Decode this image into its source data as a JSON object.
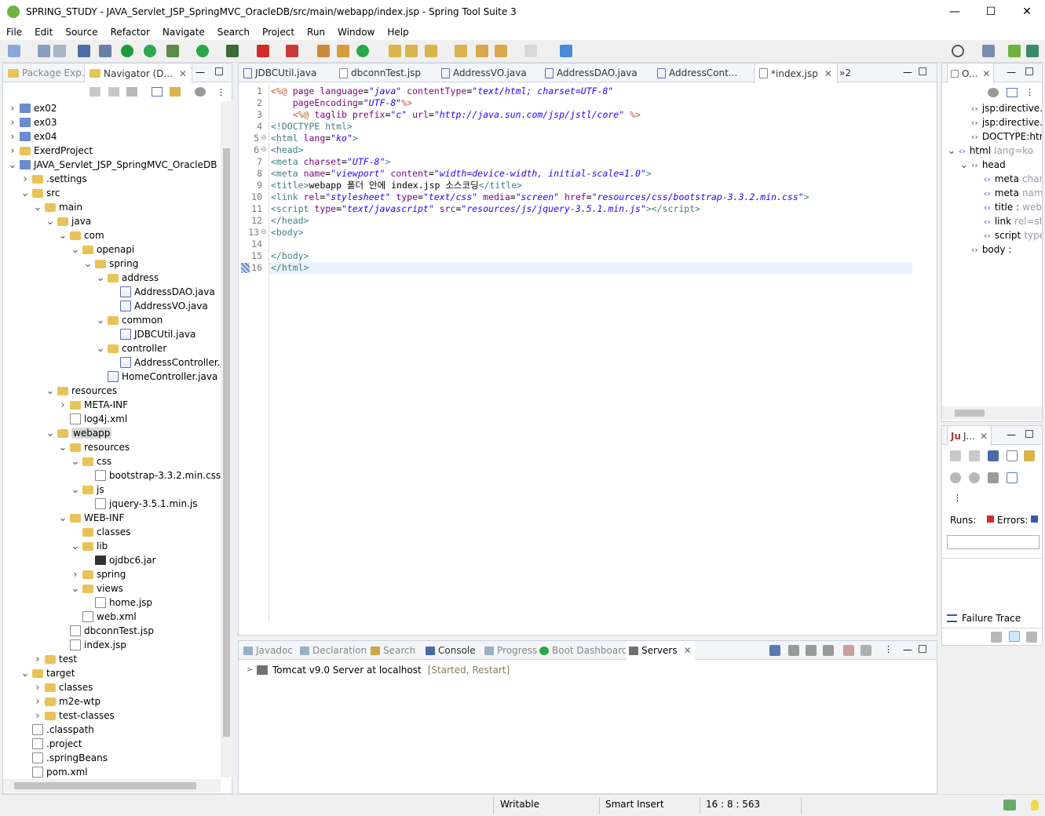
{
  "window": {
    "title": "SPRING_STUDY - JAVA_Servlet_JSP_SpringMVC_OracleDB/src/main/webapp/index.jsp - Spring Tool Suite 3",
    "minimize_glyph": "—",
    "maximize_glyph": "☐",
    "close_glyph": "✕"
  },
  "menu": [
    "File",
    "Edit",
    "Source",
    "Refactor",
    "Navigate",
    "Search",
    "Project",
    "Run",
    "Window",
    "Help"
  ],
  "left_panel": {
    "tabs": [
      "Package Exp...",
      "Navigator (D..."
    ],
    "tree": [
      {
        "label": "ex02",
        "depth": 0,
        "icon": "proj",
        "twisty": ">"
      },
      {
        "label": "ex03",
        "depth": 0,
        "icon": "proj",
        "twisty": ">"
      },
      {
        "label": "ex04",
        "depth": 0,
        "icon": "proj",
        "twisty": ">"
      },
      {
        "label": "ExerdProject",
        "depth": 0,
        "icon": "folder",
        "twisty": ">"
      },
      {
        "label": "JAVA_Servlet_JSP_SpringMVC_OracleDB",
        "depth": 0,
        "icon": "proj",
        "twisty": "v"
      },
      {
        "label": ".settings",
        "depth": 1,
        "icon": "folder",
        "twisty": ">"
      },
      {
        "label": "src",
        "depth": 1,
        "icon": "folder",
        "twisty": "v"
      },
      {
        "label": "main",
        "depth": 2,
        "icon": "folder",
        "twisty": "v"
      },
      {
        "label": "java",
        "depth": 3,
        "icon": "folder",
        "twisty": "v"
      },
      {
        "label": "com",
        "depth": 4,
        "icon": "folder",
        "twisty": "v"
      },
      {
        "label": "openapi",
        "depth": 5,
        "icon": "folder",
        "twisty": "v"
      },
      {
        "label": "spring",
        "depth": 6,
        "icon": "folder",
        "twisty": "v"
      },
      {
        "label": "address",
        "depth": 7,
        "icon": "folder",
        "twisty": "v"
      },
      {
        "label": "AddressDAO.java",
        "depth": 8,
        "icon": "java",
        "twisty": ""
      },
      {
        "label": "AddressVO.java",
        "depth": 8,
        "icon": "java",
        "twisty": ""
      },
      {
        "label": "common",
        "depth": 7,
        "icon": "folder",
        "twisty": "v"
      },
      {
        "label": "JDBCUtil.java",
        "depth": 8,
        "icon": "java",
        "twisty": ""
      },
      {
        "label": "controller",
        "depth": 7,
        "icon": "folder",
        "twisty": "v"
      },
      {
        "label": "AddressController.ja",
        "depth": 8,
        "icon": "java",
        "twisty": ""
      },
      {
        "label": "HomeController.java",
        "depth": 7,
        "icon": "java",
        "twisty": ""
      },
      {
        "label": "resources",
        "depth": 3,
        "icon": "folder",
        "twisty": "v"
      },
      {
        "label": "META-INF",
        "depth": 4,
        "icon": "folder",
        "twisty": ">"
      },
      {
        "label": "log4j.xml",
        "depth": 4,
        "icon": "xml",
        "twisty": ""
      },
      {
        "label": "webapp",
        "depth": 3,
        "icon": "folder",
        "twisty": "v",
        "selected": true
      },
      {
        "label": "resources",
        "depth": 4,
        "icon": "folder",
        "twisty": "v"
      },
      {
        "label": "css",
        "depth": 5,
        "icon": "folder",
        "twisty": "v"
      },
      {
        "label": "bootstrap-3.3.2.min.css",
        "depth": 6,
        "icon": "xml",
        "twisty": ""
      },
      {
        "label": "js",
        "depth": 5,
        "icon": "folder",
        "twisty": "v"
      },
      {
        "label": "jquery-3.5.1.min.js",
        "depth": 6,
        "icon": "xml",
        "twisty": ""
      },
      {
        "label": "WEB-INF",
        "depth": 4,
        "icon": "folder",
        "twisty": "v"
      },
      {
        "label": "classes",
        "depth": 5,
        "icon": "folder",
        "twisty": ""
      },
      {
        "label": "lib",
        "depth": 5,
        "icon": "folder",
        "twisty": "v"
      },
      {
        "label": "ojdbc6.jar",
        "depth": 6,
        "icon": "jar",
        "twisty": ""
      },
      {
        "label": "spring",
        "depth": 5,
        "icon": "folder",
        "twisty": ">"
      },
      {
        "label": "views",
        "depth": 5,
        "icon": "folder",
        "twisty": "v"
      },
      {
        "label": "home.jsp",
        "depth": 6,
        "icon": "xml",
        "twisty": ""
      },
      {
        "label": "web.xml",
        "depth": 5,
        "icon": "xml",
        "twisty": ""
      },
      {
        "label": "dbconnTest.jsp",
        "depth": 4,
        "icon": "xml",
        "twisty": ""
      },
      {
        "label": "index.jsp",
        "depth": 4,
        "icon": "xml",
        "twisty": ""
      },
      {
        "label": "test",
        "depth": 2,
        "icon": "folder",
        "twisty": ">"
      },
      {
        "label": "target",
        "depth": 1,
        "icon": "folder",
        "twisty": "v"
      },
      {
        "label": "classes",
        "depth": 2,
        "icon": "folder",
        "twisty": ">"
      },
      {
        "label": "m2e-wtp",
        "depth": 2,
        "icon": "folder",
        "twisty": ">"
      },
      {
        "label": "test-classes",
        "depth": 2,
        "icon": "folder",
        "twisty": ">"
      },
      {
        "label": ".classpath",
        "depth": 1,
        "icon": "xml",
        "twisty": ""
      },
      {
        "label": ".project",
        "depth": 1,
        "icon": "xml",
        "twisty": ""
      },
      {
        "label": ".springBeans",
        "depth": 1,
        "icon": "xml",
        "twisty": ""
      },
      {
        "label": "pom.xml",
        "depth": 1,
        "icon": "xml",
        "twisty": ""
      }
    ]
  },
  "editor": {
    "tabs": [
      "JDBCUtil.java",
      "dbconnTest.jsp",
      "AddressVO.java",
      "AddressDAO.java",
      "AddressCont...",
      "*index.jsp"
    ],
    "overflow_label": "»2",
    "lines": [
      {
        "n": "1",
        "html": "<span class='jsp'>&lt;%@</span> <span class='at'>page</span> <span class='at'>language</span>=<span class='av'>\"java\"</span> <span class='at'>contentType</span>=<span class='av'>\"text/html; charset=UTF-8\"</span>"
      },
      {
        "n": "2",
        "html": "    <span class='at'>pageEncoding</span>=<span class='av'>\"UTF-8\"</span><span class='jsp'>%&gt;</span>"
      },
      {
        "n": "3",
        "html": "    <span class='jsp'>&lt;%@</span> <span class='at'>taglib</span> <span class='at'>prefix</span>=<span class='av'>\"c\"</span> <span class='at'>url</span>=<span class='av'>\"http://java.sun.com/jsp/jstl/core\"</span> <span class='jsp'>%&gt;</span>"
      },
      {
        "n": "4",
        "html": "<span class='tg'>&lt;!DOCTYPE html&gt;</span>"
      },
      {
        "n": "5",
        "html": "<span class='tg'>&lt;html</span> <span class='at'>lang</span>=<span class='av'>\"ko\"</span><span class='tg'>&gt;</span>"
      },
      {
        "n": "6",
        "html": "<span class='tg'>&lt;head&gt;</span>"
      },
      {
        "n": "7",
        "html": "<span class='tg'>&lt;meta</span> <span class='at'>charset</span>=<span class='av'>\"UTF-8\"</span><span class='tg'>&gt;</span>"
      },
      {
        "n": "8",
        "html": "<span class='tg'>&lt;meta</span> <span class='at'>name</span>=<span class='av'>\"viewport\"</span> <span class='at'>content</span>=<span class='av'>\"width=device-width, initial-scale=1.0\"</span><span class='tg'>&gt;</span>"
      },
      {
        "n": "9",
        "html": "<span class='tg'>&lt;title&gt;</span><span class='tx'>webapp 폴더 안에 index.jsp 소스코딩</span><span class='tg'>&lt;/title&gt;</span>"
      },
      {
        "n": "10",
        "html": "<span class='tg'>&lt;link</span> <span class='at'>rel</span>=<span class='av'>\"stylesheet\"</span> <span class='at'>type</span>=<span class='av'>\"text/css\"</span> <span class='at'>media</span>=<span class='av'>\"screen\"</span> <span class='at'>href</span>=<span class='av'>\"resources/css/bootstrap-3.3.2.min.css\"</span><span class='tg'>&gt;</span>"
      },
      {
        "n": "11",
        "html": "<span class='tg'>&lt;script</span> <span class='at'>type</span>=<span class='av'>\"text/javascript\"</span> <span class='at'>src</span>=<span class='av'>\"resources/js/jquery-3.5.1.min.js\"</span><span class='tg'>&gt;&lt;/script&gt;</span>"
      },
      {
        "n": "12",
        "html": "<span class='tg'>&lt;/head&gt;</span>"
      },
      {
        "n": "13",
        "html": "<span class='tg'>&lt;body&gt;</span>"
      },
      {
        "n": "14",
        "html": ""
      },
      {
        "n": "15",
        "html": "<span class='tg'>&lt;/body&gt;</span>"
      },
      {
        "n": "16",
        "html": "<span class='tg'>&lt;/html&gt;</span>"
      }
    ],
    "fold_glyph": "⊖"
  },
  "outline": {
    "tab": "O...",
    "items": [
      {
        "label": "jsp:directive.pag",
        "hint": "",
        "depth": 1,
        "twisty": ""
      },
      {
        "label": "jsp:directive.tagl",
        "hint": "",
        "depth": 1,
        "twisty": ""
      },
      {
        "label": "DOCTYPE:html",
        "hint": "",
        "depth": 1,
        "twisty": ""
      },
      {
        "label": "html",
        "hint": "lang=ko",
        "depth": 0,
        "twisty": "v"
      },
      {
        "label": "head",
        "hint": "",
        "depth": 1,
        "twisty": "v"
      },
      {
        "label": "meta",
        "hint": "char",
        "depth": 2,
        "twisty": ""
      },
      {
        "label": "meta",
        "hint": "nam",
        "depth": 2,
        "twisty": ""
      },
      {
        "label": "title :",
        "hint": "web",
        "depth": 2,
        "twisty": ""
      },
      {
        "label": "link",
        "hint": "rel=st",
        "depth": 2,
        "twisty": ""
      },
      {
        "label": "script",
        "hint": "type",
        "depth": 2,
        "twisty": ""
      },
      {
        "label": "body :",
        "hint": "",
        "depth": 1,
        "twisty": ""
      }
    ]
  },
  "junit": {
    "tab": "J...",
    "runs_label": "Runs:",
    "errors_label": "Errors:",
    "failure_trace_label": "Failure Trace"
  },
  "bottom": {
    "tabs": [
      "Javadoc",
      "Declaration",
      "Search",
      "Console",
      "Progress",
      "Boot Dashboard",
      "Servers"
    ],
    "server_name": "Tomcat v9.0 Server at localhost",
    "server_state": "[Started, Restart]"
  },
  "status": {
    "writable": "Writable",
    "insert_mode": "Smart Insert",
    "position": "16 : 8 : 563"
  },
  "colors": {
    "accent": "#6db33f",
    "selection": "#cce8ff",
    "current_line": "#e8f2fe"
  }
}
